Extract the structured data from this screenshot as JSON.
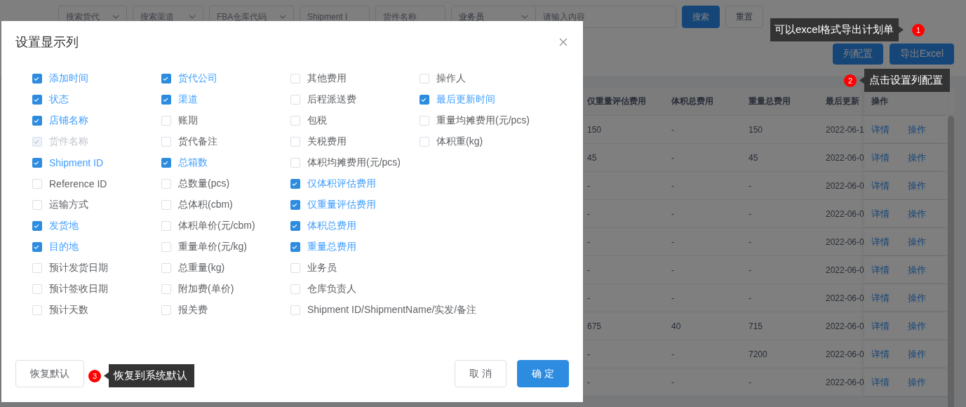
{
  "filters": [
    {
      "kind": "select",
      "placeholder": "搜索货代"
    },
    {
      "kind": "select",
      "placeholder": "搜索渠道"
    },
    {
      "kind": "select",
      "placeholder": "FBA仓库代码"
    },
    {
      "kind": "input",
      "placeholder": "Shipment I"
    },
    {
      "kind": "input",
      "placeholder": "货件名称"
    }
  ],
  "search_group": {
    "field": "业务员",
    "placeholder": "请输入内容"
  },
  "filter_buttons": [
    {
      "label": "搜索",
      "kind": "primary"
    },
    {
      "label": "重置",
      "kind": "default"
    }
  ],
  "toolbar_buttons": [
    "列配置",
    "导出Excel"
  ],
  "table": {
    "columns": [
      "仅重量评估费用",
      "体积总费用",
      "重量总费用",
      "最后更新"
    ],
    "action_column": "操作",
    "rows": [
      {
        "cells": [
          "150",
          "-",
          "150",
          "2022-06-1"
        ],
        "actions": [
          "详情",
          "操作"
        ]
      },
      {
        "cells": [
          "45",
          "-",
          "45",
          "2022-06-0"
        ],
        "actions": [
          "详情",
          "操作"
        ]
      },
      {
        "cells": [
          "-",
          "-",
          "-",
          "2022-06-0"
        ],
        "actions": [
          "详情",
          "操作"
        ]
      },
      {
        "cells": [
          "-",
          "-",
          "-",
          "2022-06-0"
        ],
        "actions": [
          "详情",
          "操作"
        ]
      },
      {
        "cells": [
          "-",
          "-",
          "-",
          "2022-06-0"
        ],
        "actions": [
          "详情",
          "操作"
        ]
      },
      {
        "cells": [
          "-",
          "-",
          "-",
          "2022-06-0"
        ],
        "actions": [
          "详情",
          "操作"
        ]
      },
      {
        "cells": [
          "-",
          "-",
          "-",
          "2022-06-0"
        ],
        "actions": [
          "详情",
          "操作"
        ]
      },
      {
        "cells": [
          "675",
          "40",
          "715",
          "2022-06-0"
        ],
        "actions": [
          "详情",
          "操作"
        ]
      },
      {
        "cells": [
          "-",
          "-",
          "7200",
          "2022-06-0"
        ],
        "actions": [
          "详情",
          "操作"
        ]
      },
      {
        "cells": [
          "-",
          "-",
          "-",
          "2022-06-0"
        ],
        "actions": [
          "详情",
          "操作"
        ]
      }
    ]
  },
  "dialog": {
    "title": "设置显示列",
    "columns": [
      {
        "options": [
          {
            "label": "添加时间",
            "checked": true,
            "disabled": false
          },
          {
            "label": "状态",
            "checked": true,
            "disabled": false
          },
          {
            "label": "店铺名称",
            "checked": true,
            "disabled": false
          },
          {
            "label": "货件名称",
            "checked": true,
            "disabled": true
          },
          {
            "label": "Shipment ID",
            "checked": true,
            "disabled": false
          },
          {
            "label": "Reference ID",
            "checked": false,
            "disabled": false
          },
          {
            "label": "运输方式",
            "checked": false,
            "disabled": false
          },
          {
            "label": "发货地",
            "checked": true,
            "disabled": false
          },
          {
            "label": "目的地",
            "checked": true,
            "disabled": false
          },
          {
            "label": "预计发货日期",
            "checked": false,
            "disabled": false
          },
          {
            "label": "预计签收日期",
            "checked": false,
            "disabled": false
          },
          {
            "label": "预计天数",
            "checked": false,
            "disabled": false
          }
        ]
      },
      {
        "options": [
          {
            "label": "货代公司",
            "checked": true,
            "disabled": false
          },
          {
            "label": "渠道",
            "checked": true,
            "disabled": false
          },
          {
            "label": "账期",
            "checked": false,
            "disabled": false
          },
          {
            "label": "货代备注",
            "checked": false,
            "disabled": false
          },
          {
            "label": "总箱数",
            "checked": true,
            "disabled": false
          },
          {
            "label": "总数量(pcs)",
            "checked": false,
            "disabled": false
          },
          {
            "label": "总体积(cbm)",
            "checked": false,
            "disabled": false
          },
          {
            "label": "体积单价(元/cbm)",
            "checked": false,
            "disabled": false
          },
          {
            "label": "重量单价(元/kg)",
            "checked": false,
            "disabled": false
          },
          {
            "label": "总重量(kg)",
            "checked": false,
            "disabled": false
          },
          {
            "label": "附加费(单价)",
            "checked": false,
            "disabled": false
          },
          {
            "label": "报关费",
            "checked": false,
            "disabled": false
          }
        ]
      },
      {
        "options": [
          {
            "label": "其他费用",
            "checked": false,
            "disabled": false
          },
          {
            "label": "后程派送费",
            "checked": false,
            "disabled": false
          },
          {
            "label": "包税",
            "checked": false,
            "disabled": false
          },
          {
            "label": "关税费用",
            "checked": false,
            "disabled": false
          },
          {
            "label": "体积均摊费用(元/pcs)",
            "checked": false,
            "disabled": false
          },
          {
            "label": "仅体积评估费用",
            "checked": true,
            "disabled": false
          },
          {
            "label": "仅重量评估费用",
            "checked": true,
            "disabled": false
          },
          {
            "label": "体积总费用",
            "checked": true,
            "disabled": false
          },
          {
            "label": "重量总费用",
            "checked": true,
            "disabled": false
          },
          {
            "label": "业务员",
            "checked": false,
            "disabled": false
          },
          {
            "label": "仓库负责人",
            "checked": false,
            "disabled": false
          },
          {
            "label": "Shipment ID/ShipmentName/实发/备注",
            "checked": false,
            "disabled": false
          }
        ]
      },
      {
        "options": [
          {
            "label": "操作人",
            "checked": false,
            "disabled": false
          },
          {
            "label": "最后更新时间",
            "checked": true,
            "disabled": false
          },
          {
            "label": "重量均摊费用(元/pcs)",
            "checked": false,
            "disabled": false
          },
          {
            "label": "体积重(kg)",
            "checked": false,
            "disabled": false
          }
        ]
      }
    ],
    "buttons": [
      {
        "label": "恢复默认",
        "kind": "default"
      },
      {
        "label": "取 消",
        "kind": "default"
      },
      {
        "label": "确 定",
        "kind": "primary"
      }
    ]
  },
  "annotations": [
    {
      "number": "1",
      "text": "可以excel格式导出计划单"
    },
    {
      "number": "2",
      "text": "点击设置列配置"
    },
    {
      "number": "3",
      "text": "恢复到系统默认"
    }
  ]
}
